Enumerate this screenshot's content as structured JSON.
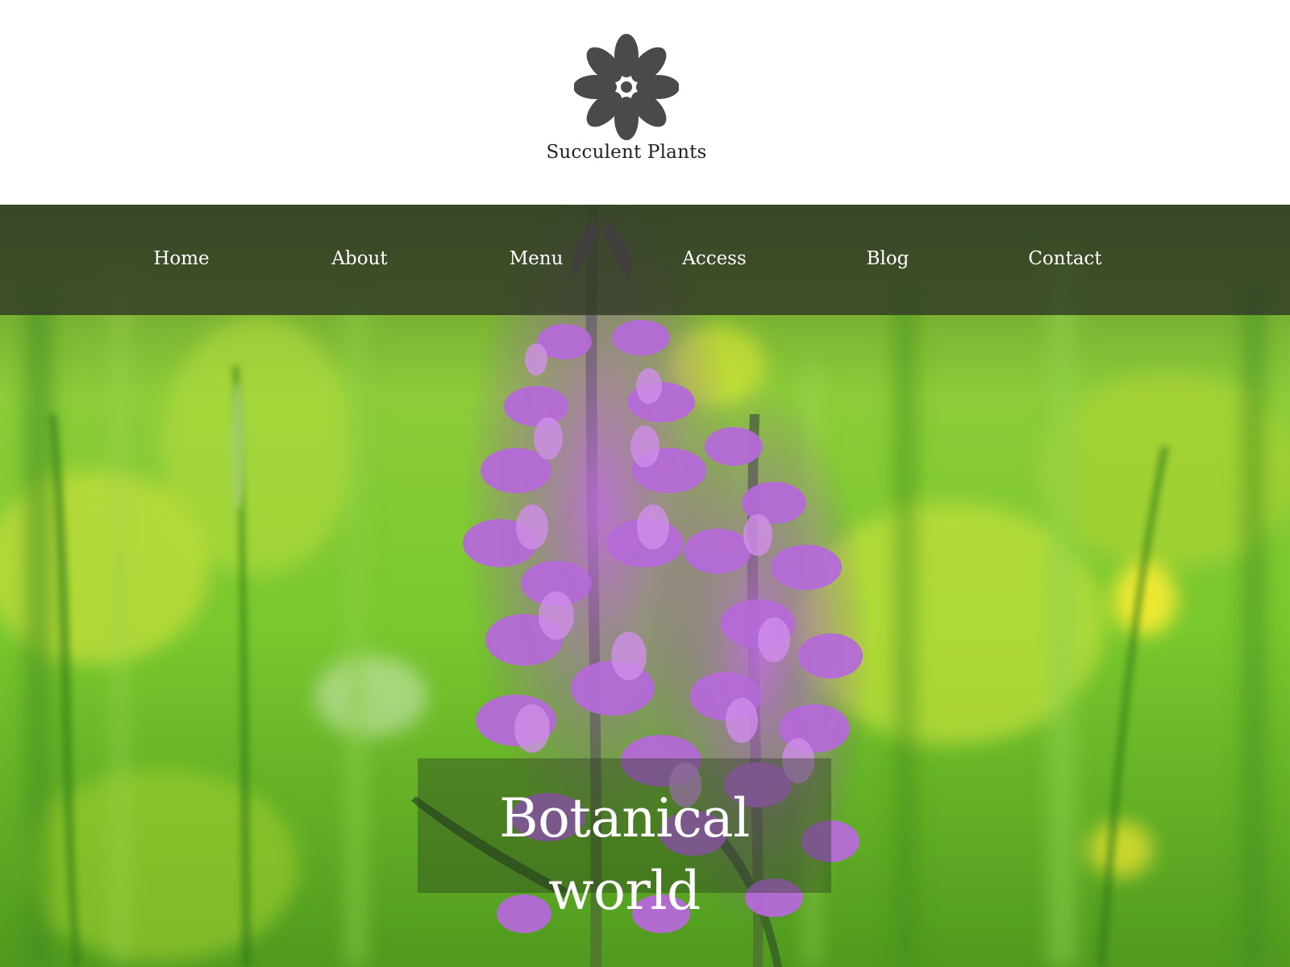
{
  "header": {
    "logo_icon": "flower-icon",
    "brand_name": "Succulent Plants"
  },
  "nav": {
    "items": [
      {
        "label": "Home"
      },
      {
        "label": "About"
      },
      {
        "label": "Menu"
      },
      {
        "label": "Access"
      },
      {
        "label": "Blog"
      },
      {
        "label": "Contact"
      }
    ]
  },
  "hero": {
    "headline": "Botanical world"
  },
  "colors": {
    "logo_gray": "#4a4a4a",
    "nav_overlay": "#2f3725",
    "text_light": "#ffffff",
    "grass_green": "#6fbf2a",
    "orchid_purple": "#a04bc8"
  }
}
